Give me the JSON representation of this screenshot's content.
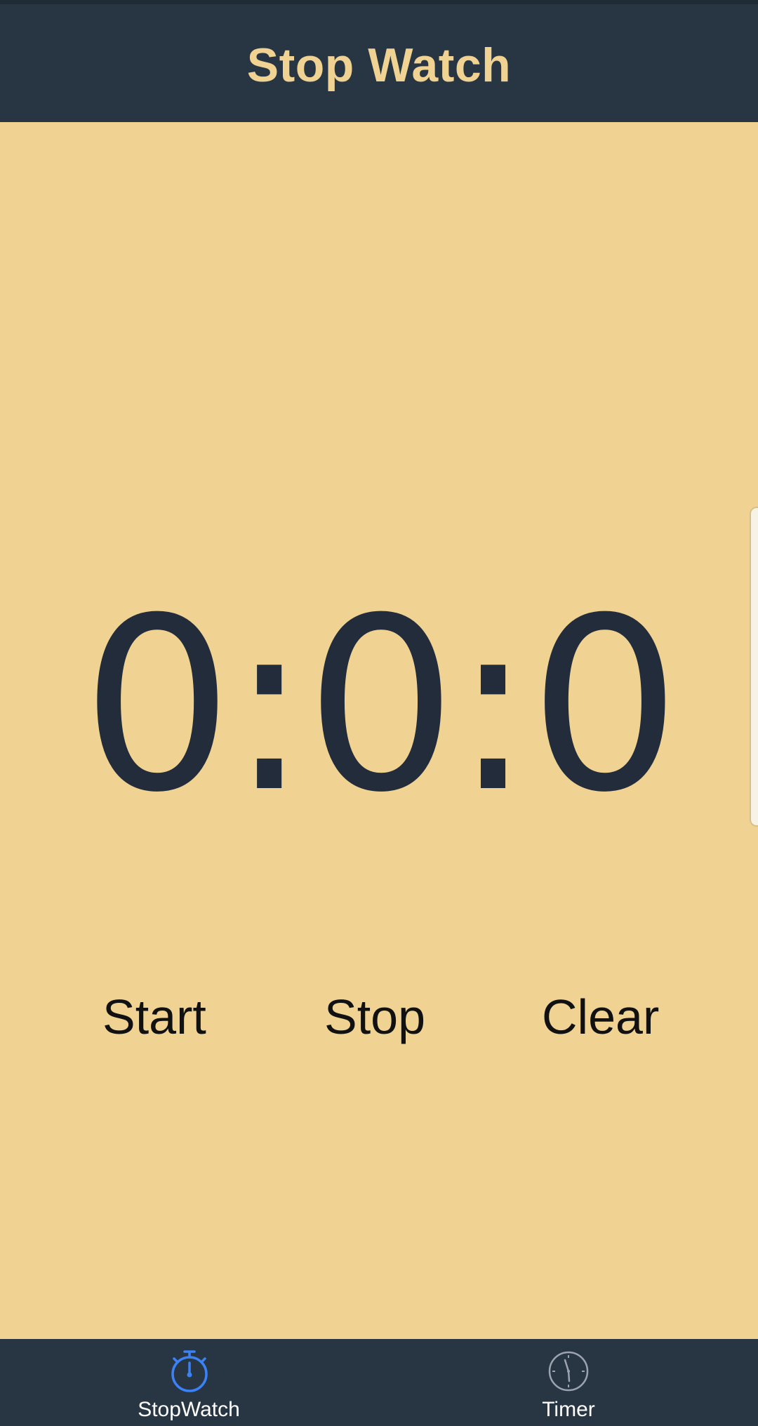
{
  "app": {
    "title": "Stop Watch"
  },
  "display": {
    "time": "0:0:0"
  },
  "actions": {
    "start_label": "Start",
    "stop_label": "Stop",
    "clear_label": "Clear"
  },
  "tabs": [
    {
      "label": "StopWatch",
      "icon": "stopwatch-icon",
      "active": true
    },
    {
      "label": "Timer",
      "icon": "clock-icon",
      "active": false
    }
  ],
  "colors": {
    "header_bg": "#283643",
    "page_bg": "#f0d393",
    "title_text": "#f0d393",
    "time_text": "#222c3a",
    "tab_active_icon": "#3b82f6",
    "tab_inactive_icon": "#9ca3af"
  }
}
